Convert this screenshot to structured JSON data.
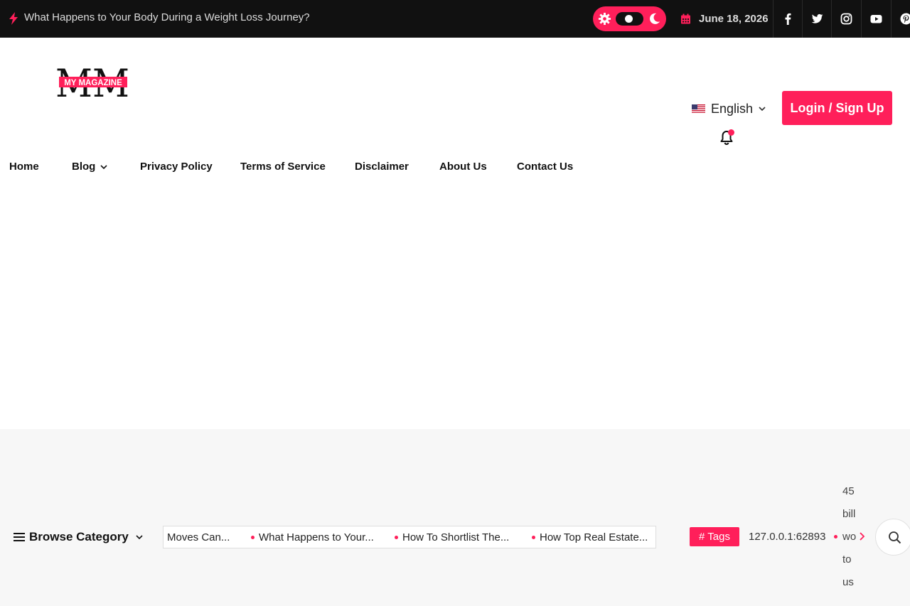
{
  "topbar": {
    "headline": "What Happens to Your Body During a Weight Loss Journey?",
    "date": "June 18, 2026",
    "social_icons": [
      "facebook-icon",
      "twitter-icon",
      "instagram-icon",
      "youtube-icon",
      "pinterest-icon"
    ]
  },
  "header": {
    "logo_letters": "MM",
    "logo_text": "MY MAGAZINE",
    "language": "English",
    "login_label": "Login / Sign Up"
  },
  "nav": {
    "items": [
      "Home",
      "Blog",
      "Privacy Policy",
      "Terms of Service",
      "Disclaimer",
      "About Us",
      "Contact Us"
    ]
  },
  "bottom": {
    "browse_label": "Browse Category",
    "ticker": [
      "Moves Can...",
      "What Happens to Your...",
      "How To Shortlist The...",
      "How Top Real Estate..."
    ],
    "tags_label": "# Tags",
    "url_text": "127.0.0.1:62893",
    "side_words": [
      "45",
      "bill",
      "wo",
      "to",
      "us"
    ]
  },
  "colors": {
    "accent": "#ff1f5a",
    "topbar_bg": "#111111",
    "band_bg": "#f7f7f7"
  }
}
